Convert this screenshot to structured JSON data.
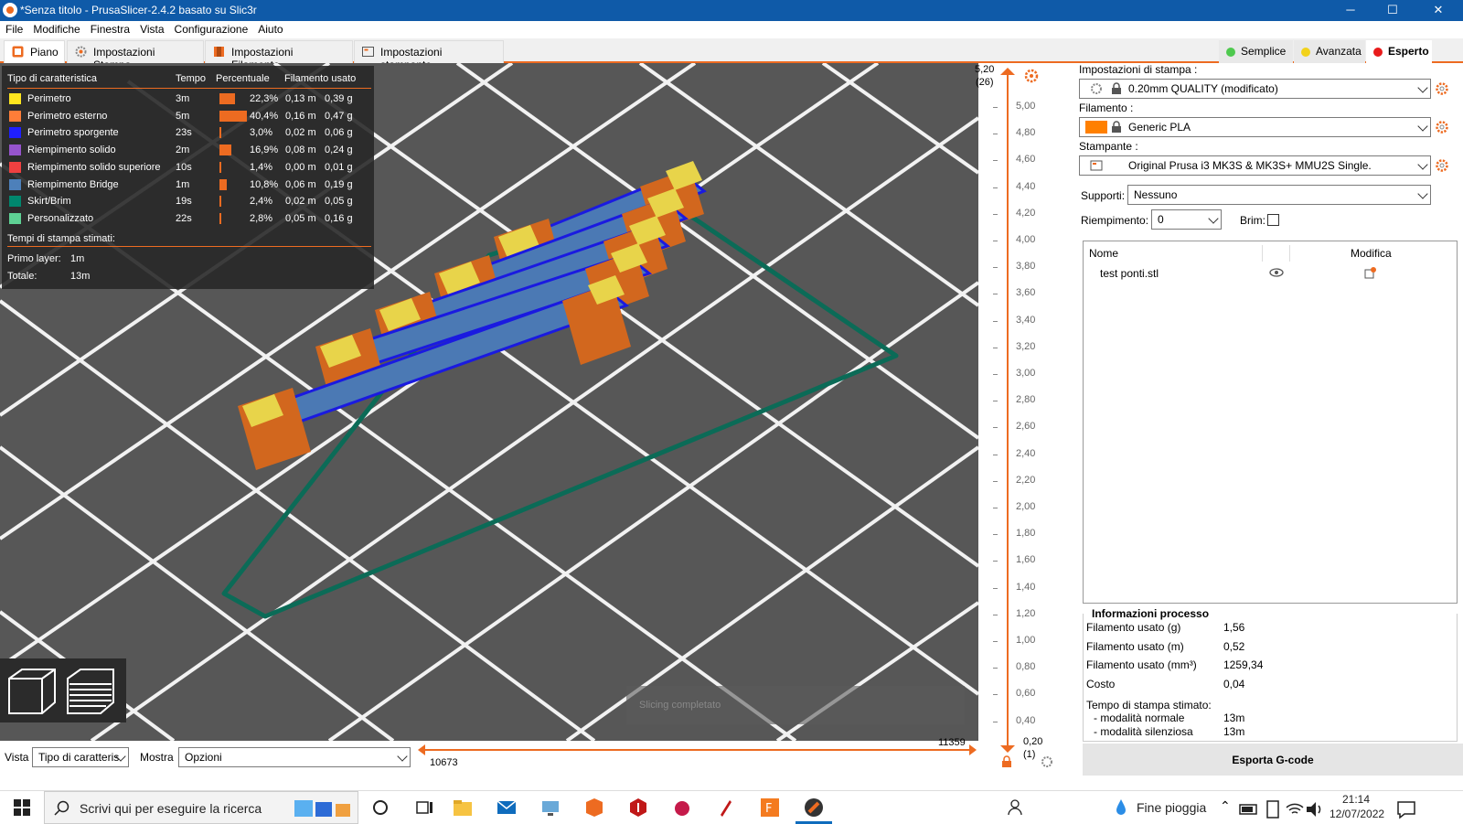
{
  "window": {
    "title": "*Senza titolo - PrusaSlicer-2.4.2 basato su Slic3r",
    "minimize": "─",
    "maximize": "☐",
    "close": "✕"
  },
  "menu": [
    "File",
    "Modifiche",
    "Finestra",
    "Vista",
    "Configurazione",
    "Aiuto"
  ],
  "tabs": [
    {
      "label": "Piano"
    },
    {
      "label": "Impostazioni Stampa"
    },
    {
      "label": "Impostazioni Filamento"
    },
    {
      "label": "Impostazioni stampante"
    }
  ],
  "modes": [
    {
      "label": "Semplice",
      "color": "#4ec94e"
    },
    {
      "label": "Avanzata",
      "color": "#f2d21b"
    },
    {
      "label": "Esperto",
      "color": "#e81b1b"
    }
  ],
  "legend": {
    "headers": {
      "type": "Tipo di caratteristica",
      "time": "Tempo",
      "percent": "Percentuale",
      "filament": "Filamento usato"
    },
    "rows": [
      {
        "name": "Perimetro",
        "color": "#ffe61e",
        "time": "3m",
        "percent": "22,3%",
        "pct_value": 22.3,
        "m": "0,13 m",
        "g": "0,39 g"
      },
      {
        "name": "Perimetro esterno",
        "color": "#ff7d38",
        "time": "5m",
        "percent": "40,4%",
        "pct_value": 40.4,
        "m": "0,16 m",
        "g": "0,47 g"
      },
      {
        "name": "Perimetro sporgente",
        "color": "#1f1fff",
        "time": "23s",
        "percent": "3,0%",
        "pct_value": 3.0,
        "m": "0,02 m",
        "g": "0,06 g"
      },
      {
        "name": "Riempimento solido",
        "color": "#9654cc",
        "time": "2m",
        "percent": "16,9%",
        "pct_value": 16.9,
        "m": "0,08 m",
        "g": "0,24 g"
      },
      {
        "name": "Riempimento solido superiore",
        "color": "#f04040",
        "time": "10s",
        "percent": "1,4%",
        "pct_value": 1.4,
        "m": "0,00 m",
        "g": "0,01 g"
      },
      {
        "name": "Riempimento Bridge",
        "color": "#4d80ba",
        "time": "1m",
        "percent": "10,8%",
        "pct_value": 10.8,
        "m": "0,06 m",
        "g": "0,19 g"
      },
      {
        "name": "Skirt/Brim",
        "color": "#00876e",
        "time": "19s",
        "percent": "2,4%",
        "pct_value": 2.4,
        "m": "0,02 m",
        "g": "0,05 g"
      },
      {
        "name": "Personalizzato",
        "color": "#5ed194",
        "time": "22s",
        "percent": "2,8%",
        "pct_value": 2.8,
        "m": "0,05 m",
        "g": "0,16 g"
      }
    ],
    "times_title": "Tempi di stampa stimati:",
    "first_layer_label": "Primo layer:",
    "first_layer_value": "1m",
    "total_label": "Totale:",
    "total_value": "13m"
  },
  "viewport": {
    "status": "Slicing completato"
  },
  "vslider": {
    "top_value": "5,20",
    "top_layer": "(26)",
    "bottom_value": "0,20",
    "bottom_layer": "(1)",
    "ticks": [
      "5,00",
      "4,80",
      "4,60",
      "4,40",
      "4,20",
      "4,00",
      "3,80",
      "3,60",
      "3,40",
      "3,20",
      "3,00",
      "2,80",
      "2,60",
      "2,40",
      "2,20",
      "2,00",
      "1,80",
      "1,60",
      "1,40",
      "1,20",
      "1,00",
      "0,80",
      "0,60",
      "0,40"
    ]
  },
  "bottom": {
    "vista_label": "Vista",
    "vista_value": "Tipo di caratteris",
    "mostra_label": "Mostra",
    "mostra_value": "Opzioni",
    "hslider_max": "11359",
    "hslider_min": "10673"
  },
  "right": {
    "print_label": "Impostazioni di stampa :",
    "print_value": "0.20mm QUALITY (modificato)",
    "filament_label": "Filamento :",
    "filament_value": "Generic PLA",
    "filament_color": "#ff8000",
    "printer_label": "Stampante :",
    "printer_value": "Original Prusa i3 MK3S & MK3S+ MMU2S Single.",
    "supports_label": "Supporti:",
    "supports_value": "Nessuno",
    "infill_label": "Riempimento:",
    "infill_value": "0",
    "brim_label": "Brim:",
    "objects": {
      "col_name": "Nome",
      "col_edit": "Modifica",
      "items": [
        {
          "name": "test ponti.stl"
        }
      ]
    },
    "info": {
      "title": "Informazioni processo",
      "rows": [
        {
          "label": "Filamento usato (g)",
          "value": "1,56"
        },
        {
          "label": "Filamento usato (m)",
          "value": "0,52"
        },
        {
          "label": "Filamento usato (mm³)",
          "value": "1259,34"
        },
        {
          "label": "Costo",
          "value": "0,04"
        }
      ],
      "time_title": "Tempo di stampa stimato:",
      "normal_label": "- modalità normale",
      "normal_value": "13m",
      "silent_label": "- modalità silenziosa",
      "silent_value": "13m"
    },
    "export": "Esporta G-code"
  },
  "taskbar": {
    "search_placeholder": "Scrivi qui per eseguire la ricerca",
    "weather": "Fine pioggia",
    "time": "21:14",
    "date": "12/07/2022"
  }
}
